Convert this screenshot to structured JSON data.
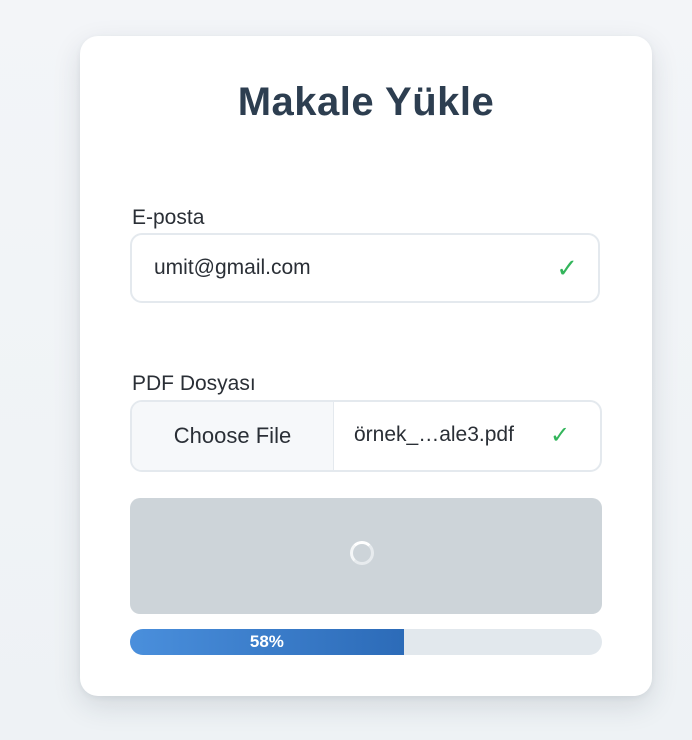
{
  "form": {
    "title": "Makale Yükle",
    "email_label": "E-posta",
    "email_value": "umit@gmail.com",
    "pdf_label": "PDF Dosyası",
    "file_button_label": "Choose File",
    "file_name": "örnek_…ale3.pdf",
    "valid_icon": "✓"
  },
  "upload": {
    "progress_text": "58%",
    "progress_percent": 58,
    "status": "uploading"
  },
  "colors": {
    "title": "#2d3e50",
    "valid": "#33b55b",
    "progress": "#3a7fd0",
    "disabled_button": "#cdd4d9"
  }
}
